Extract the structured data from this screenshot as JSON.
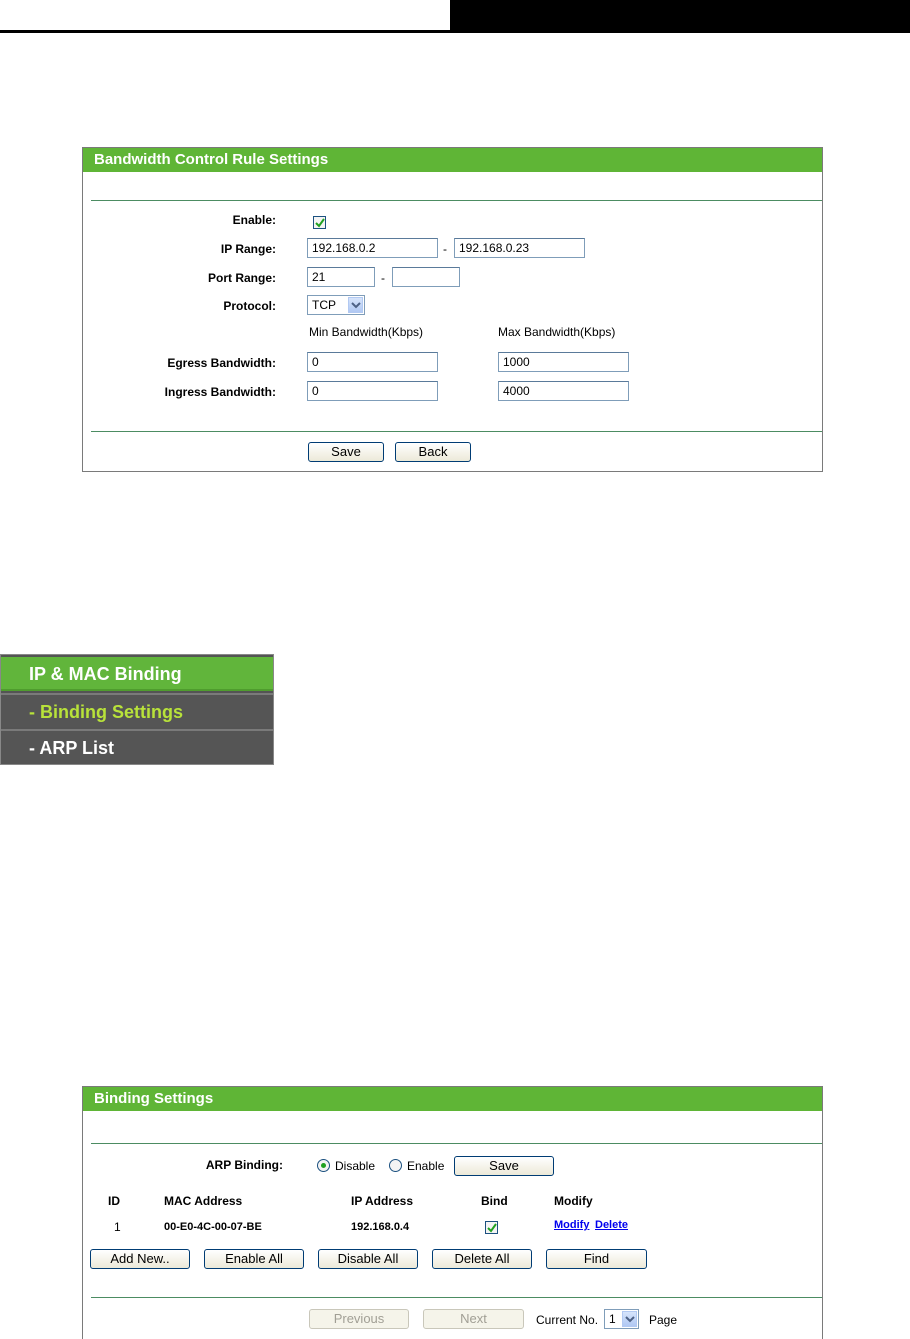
{
  "bandwidth_panel": {
    "title": "Bandwidth Control Rule Settings",
    "enable_label": "Enable:",
    "enable_checked": true,
    "ip_range_label": "IP Range:",
    "ip_start": "192.168.0.2",
    "ip_dash": "-",
    "ip_end": "192.168.0.23",
    "port_range_label": "Port Range:",
    "port_start": "21",
    "port_dash": "-",
    "port_end": "",
    "protocol_label": "Protocol:",
    "protocol_value": "TCP",
    "min_bw_header": "Min Bandwidth(Kbps)",
    "max_bw_header": "Max Bandwidth(Kbps)",
    "egress_label": "Egress Bandwidth:",
    "egress_min": "0",
    "egress_max": "1000",
    "ingress_label": "Ingress Bandwidth:",
    "ingress_min": "0",
    "ingress_max": "4000",
    "save_label": "Save",
    "back_label": "Back"
  },
  "menu": {
    "top_label": "IP & MAC Binding",
    "items": [
      {
        "label": "- Binding Settings",
        "active": true,
        "color": "#b8e23a"
      },
      {
        "label": "- ARP List",
        "active": false,
        "color": "#ffffff"
      }
    ]
  },
  "binding_panel": {
    "title": "Binding Settings",
    "arp_label": "ARP Binding:",
    "disable_label": "Disable",
    "enable_label": "Enable",
    "arp_selected": "Disable",
    "save_label": "Save",
    "table": {
      "headers": [
        "ID",
        "MAC Address",
        "IP Address",
        "Bind",
        "Modify"
      ],
      "rows": [
        {
          "id": "1",
          "mac": "00-E0-4C-00-07-BE",
          "ip": "192.168.0.4",
          "bind": true,
          "modify": "Modify",
          "delete": "Delete"
        }
      ]
    },
    "buttons": {
      "add_new": "Add New..",
      "enable_all": "Enable All",
      "disable_all": "Disable All",
      "delete_all": "Delete All",
      "find": "Find"
    },
    "pager": {
      "previous": "Previous",
      "next": "Next",
      "current_label": "Current No.",
      "current_value": "1",
      "page_label": "Page"
    }
  },
  "colors": {
    "title_green": "#5fb536",
    "menu_active": "#b8e23a",
    "link_blue": "#0000ee"
  }
}
